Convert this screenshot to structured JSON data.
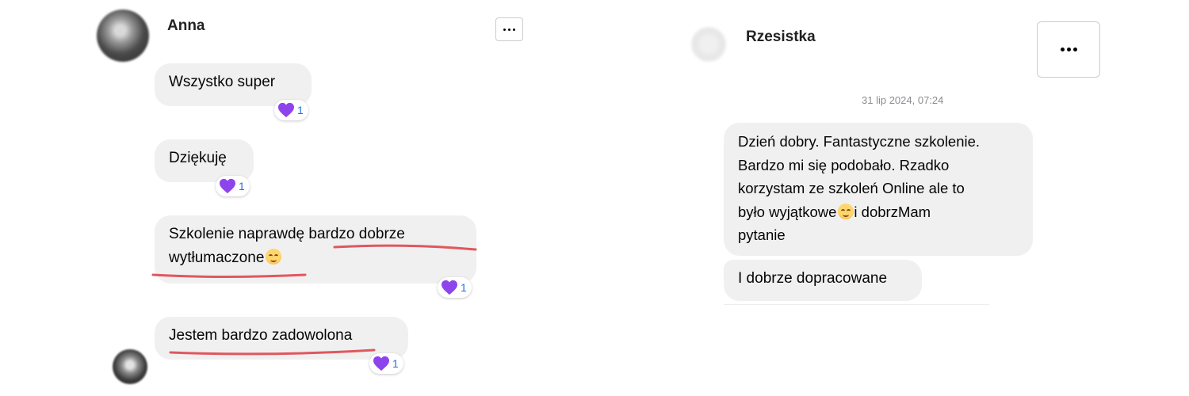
{
  "left_chat": {
    "sender_name": "Anna",
    "messages": [
      {
        "text": "Wszystko super",
        "reaction_count": "1"
      },
      {
        "text": "Dziękuję",
        "reaction_count": "1"
      },
      {
        "text_before_emoji": "Szkolenie naprawdę bardzo dobrze wytłumaczone",
        "reaction_count": "1"
      },
      {
        "text": "Jestem bardzo zadowolona",
        "reaction_count": "1"
      }
    ],
    "line1": "Szkolenie naprawdę bardzo dobrze",
    "line2": "wytłumaczone",
    "more_button_icon": "ellipsis-icon"
  },
  "right_chat": {
    "sender_name": "Rzesistka",
    "timestamp": "31 lip 2024, 07:24",
    "message1_lines": [
      "Dzień dobry. Fantastyczne szkolenie.",
      "Bardzo mi się podobało. Rzadko",
      "korzystam ze szkoleń Online ale to",
      "było wyjątkowe",
      "i dobrzMam",
      "pytanie"
    ],
    "message2": "I dobrze dopracowane",
    "more_button_icon": "ellipsis-icon"
  },
  "colors": {
    "bubble": "#f0f0f0",
    "reaction_count": "#1f6fe5",
    "heart": "#8e44ec",
    "underline": "#e0575f"
  }
}
